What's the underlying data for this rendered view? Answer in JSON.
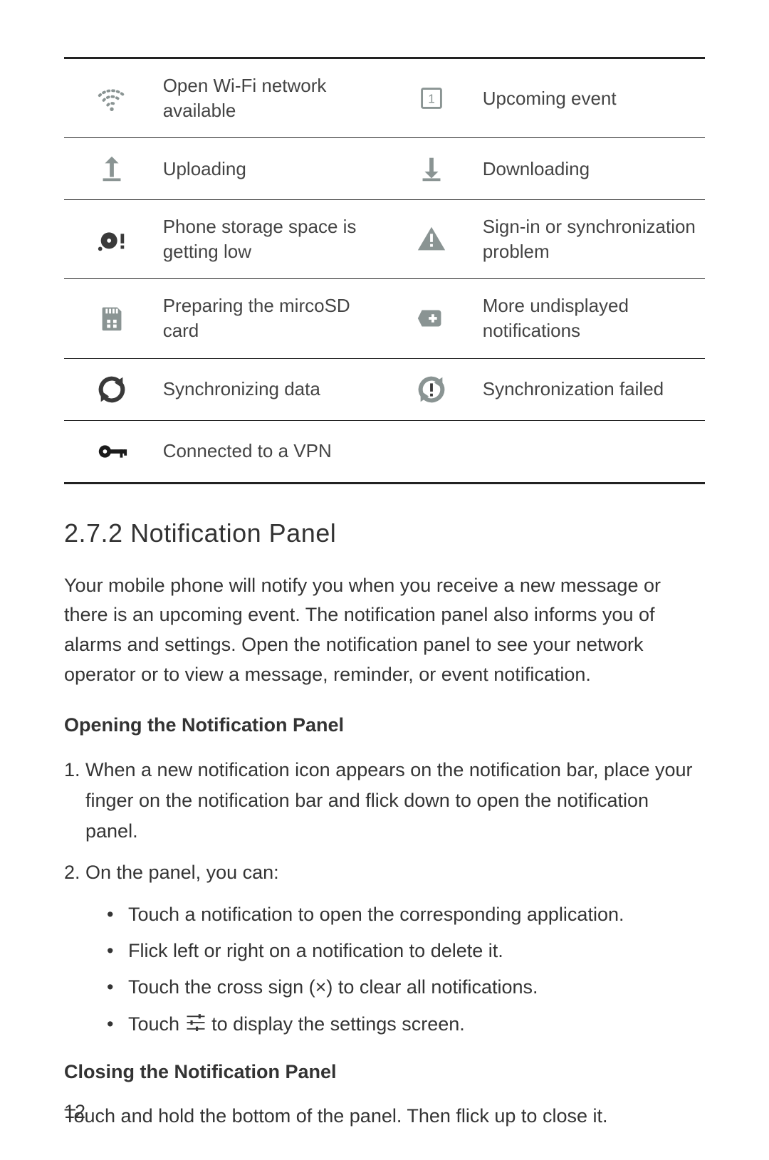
{
  "icon_rows": [
    {
      "left": {
        "icon": "wifi-open-icon",
        "label": "Open Wi-Fi network available"
      },
      "right": {
        "icon": "calendar-one-icon",
        "label": "Upcoming event"
      }
    },
    {
      "left": {
        "icon": "upload-icon",
        "label": "Uploading"
      },
      "right": {
        "icon": "download-icon",
        "label": "Downloading"
      }
    },
    {
      "left": {
        "icon": "disk-low-icon",
        "label": "Phone storage space is getting low"
      },
      "right": {
        "icon": "warning-icon",
        "label": "Sign-in or synchronization problem"
      }
    },
    {
      "left": {
        "icon": "sdcard-icon",
        "label": "Preparing the mircoSD card"
      },
      "right": {
        "icon": "more-tag-icon",
        "label": "More undisplayed notifications"
      }
    },
    {
      "left": {
        "icon": "sync-icon",
        "label": "Synchronizing data"
      },
      "right": {
        "icon": "sync-fail-icon",
        "label": "Synchronization failed"
      }
    },
    {
      "left": {
        "icon": "vpn-key-icon",
        "label": "Connected to a VPN"
      },
      "right": null
    }
  ],
  "section": {
    "heading": "2.7.2  Notification Panel",
    "intro": "Your mobile phone will notify you when you receive a new message or there is an upcoming event. The notification panel also informs you of alarms and settings. Open the notification panel to see your network operator or to view a message, reminder, or event notification.",
    "open_heading": "Opening the Notification Panel",
    "step1": "When a new notification icon appears on the notification bar, place your finger on the notification bar and flick down to open the notification panel.",
    "step2": "On the panel, you can:",
    "bullets": {
      "b1": "Touch a notification to open the corresponding application.",
      "b2": "Flick left or right on a notification to delete it.",
      "b3": "Touch the cross sign (×) to clear all notifications.",
      "b4a": "Touch ",
      "b4b": " to display the settings screen."
    },
    "close_heading": "Closing the Notification Panel",
    "close_text": "Touch and hold the bottom of the panel. Then flick up to close it."
  },
  "page_number": "12"
}
